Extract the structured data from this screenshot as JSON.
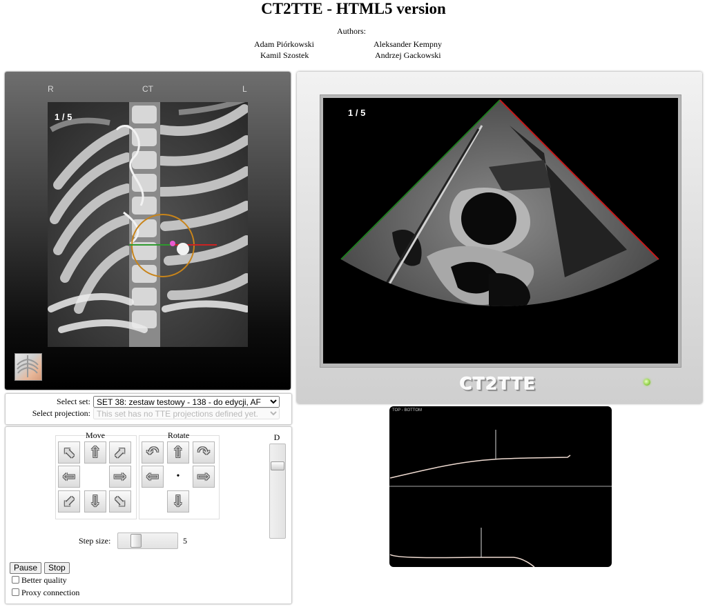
{
  "page": {
    "title": "CT2TTE - HTML5 version"
  },
  "authors": {
    "label": "Authors:",
    "left": [
      "Adam Piórkowski",
      "Kamil Szostek"
    ],
    "right": [
      "Aleksander Kempny",
      "Andrzej Gackowski"
    ]
  },
  "ct_view": {
    "orient_left": "R",
    "orient_center": "CT",
    "orient_right": "L",
    "counter": "1 / 5",
    "thumbnail_icon": "chest-scan-thumbnail"
  },
  "tte_view": {
    "counter": "1 / 5",
    "logo": "CT2TTE",
    "led_color": "#9ad650"
  },
  "selects": {
    "set_label": "Select set:",
    "set_value": "SET 38: zestaw testowy - 138 - do edycji, AF",
    "projection_label": "Select projection:",
    "projection_value": "This set has no TTE projections defined yet."
  },
  "controls": {
    "move_label": "Move",
    "rotate_label": "Rotate",
    "d_label": "D",
    "step_label": "Step size:",
    "step_value": "5",
    "step_fraction": 0.25,
    "depth_fraction": 0.2,
    "pause_label": "Pause",
    "stop_label": "Stop",
    "better_quality_label": "Better quality",
    "proxy_label": "Proxy connection",
    "center_symbol": "•"
  },
  "graph": {
    "label": "TOP - BOTTOM"
  }
}
